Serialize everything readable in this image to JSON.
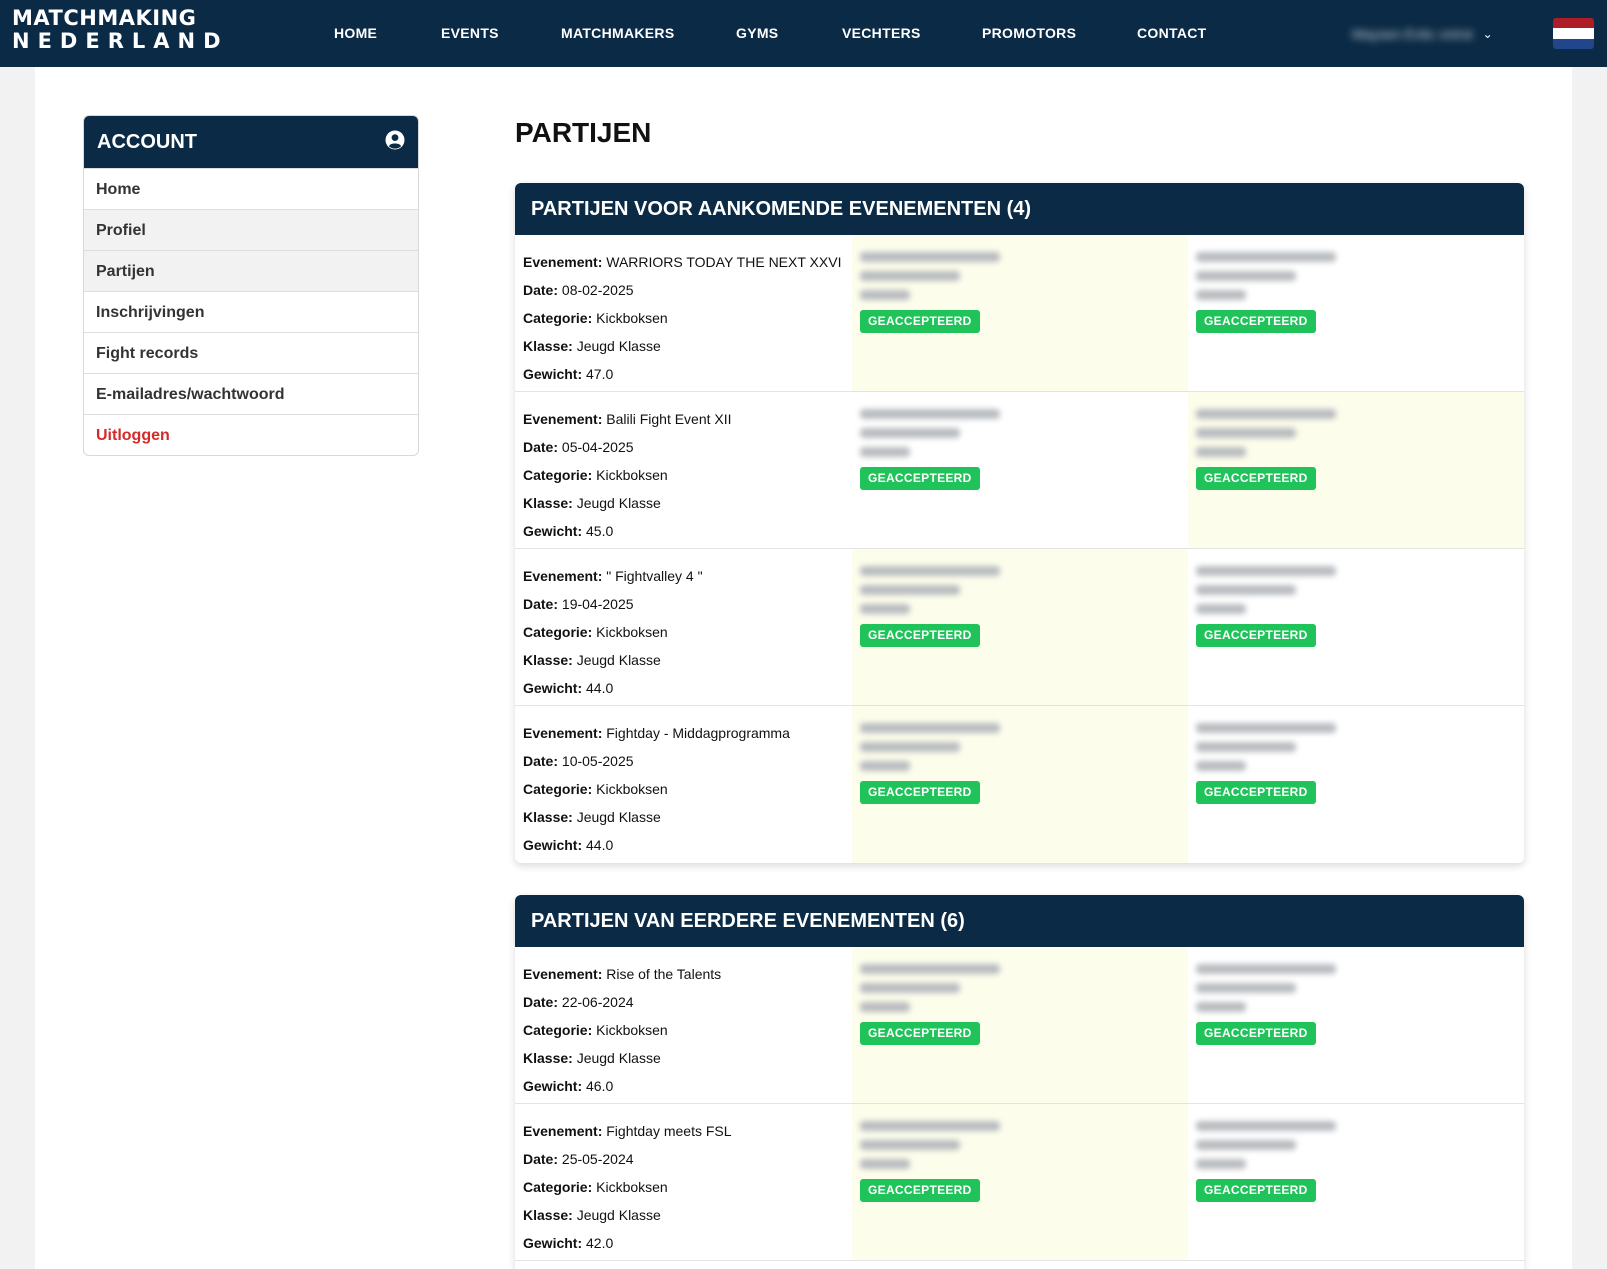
{
  "brand": {
    "line1": "MATCHMAKING",
    "line2": "NEDERLAND"
  },
  "nav": [
    "HOME",
    "EVENTS",
    "MATCHMAKERS",
    "GYMS",
    "VECHTERS",
    "PROMOTORS",
    "CONTACT"
  ],
  "user": {
    "name": "Maysen Evtic vnirst"
  },
  "colors": {
    "navy": "#0b2a45",
    "badge_green": "#20c25a",
    "logout_red": "#d42a2a",
    "highlight": "#fdfdec"
  },
  "sidebar": {
    "title": "ACCOUNT",
    "icon": "user-circle-icon",
    "items": [
      {
        "label": "Home"
      },
      {
        "label": "Profiel"
      },
      {
        "label": "Partijen"
      },
      {
        "label": "Inschrijvingen"
      },
      {
        "label": "Fight records"
      },
      {
        "label": "E-mailadres/wachtwoord"
      },
      {
        "label": "Uitloggen"
      }
    ]
  },
  "page": {
    "title": "PARTIJEN"
  },
  "labels": {
    "event": "Evenement:",
    "date": "Date:",
    "category": "Categorie:",
    "class": "Klasse:",
    "weight": "Gewicht:"
  },
  "sections": [
    {
      "title": "PARTIJEN VOOR AANKOMENDE EVENEMENTEN (4)",
      "rows": [
        {
          "event": "WARRIORS TODAY THE NEXT XXVI",
          "date": "08-02-2025",
          "category": "Kickboksen",
          "class": "Jeugd Klasse",
          "weight": "47.0",
          "status1": "GEACCEPTEERD",
          "status2": "GEACCEPTEERD"
        },
        {
          "event": "Balili Fight Event XII",
          "date": "05-04-2025",
          "category": "Kickboksen",
          "class": "Jeugd Klasse",
          "weight": "45.0",
          "status1": "GEACCEPTEERD",
          "status2": "GEACCEPTEERD"
        },
        {
          "event": "\" Fightvalley 4 \"",
          "date": "19-04-2025",
          "category": "Kickboksen",
          "class": "Jeugd Klasse",
          "weight": "44.0",
          "status1": "GEACCEPTEERD",
          "status2": "GEACCEPTEERD"
        },
        {
          "event": "Fightday - Middagprogramma",
          "date": "10-05-2025",
          "category": "Kickboksen",
          "class": "Jeugd Klasse",
          "weight": "44.0",
          "status1": "GEACCEPTEERD",
          "status2": "GEACCEPTEERD"
        }
      ]
    },
    {
      "title": "PARTIJEN VAN EERDERE EVENEMENTEN (6)",
      "rows": [
        {
          "event": "Rise of the Talents",
          "date": "22-06-2024",
          "category": "Kickboksen",
          "class": "Jeugd Klasse",
          "weight": "46.0",
          "status1": "GEACCEPTEERD",
          "status2": "GEACCEPTEERD"
        },
        {
          "event": "Fightday meets FSL",
          "date": "25-05-2024",
          "category": "Kickboksen",
          "class": "Jeugd Klasse",
          "weight": "42.0",
          "status1": "GEACCEPTEERD",
          "status2": "GEACCEPTEERD"
        }
      ]
    }
  ]
}
